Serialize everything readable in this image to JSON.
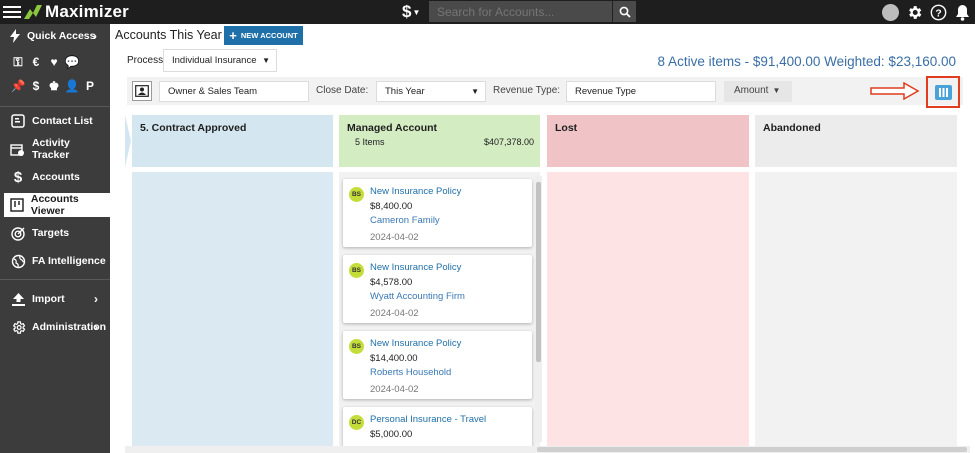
{
  "app": {
    "brand": "Maximizer",
    "currency_symbol": "$",
    "search_placeholder": "Search for Accounts..."
  },
  "sidebar": {
    "quick_access_label": "Quick Access",
    "quick_icons": [
      "key-icon",
      "euro-icon",
      "heart-icon",
      "chat-icon",
      "pin-icon",
      "dollar-icon",
      "user-icon",
      "person-icon",
      "p-badge-icon"
    ],
    "quick_glyphs": [
      "⚿",
      "€",
      "♥",
      "💬",
      "📌",
      "$",
      "♚",
      "👤",
      "P"
    ],
    "items": [
      {
        "label": "Contact List",
        "icon": "contact-list-icon"
      },
      {
        "label": "Activity Tracker",
        "icon": "calendar-icon"
      },
      {
        "label": "Accounts",
        "icon": "dollar-icon"
      },
      {
        "label": "Accounts Viewer",
        "icon": "kanban-icon",
        "active": true
      },
      {
        "label": "Targets",
        "icon": "target-icon"
      },
      {
        "label": "FA Intelligence",
        "icon": "globe-icon"
      },
      {
        "label": "Import",
        "icon": "upload-icon"
      },
      {
        "label": "Administration",
        "icon": "cog-icon"
      }
    ]
  },
  "header": {
    "title": "Accounts This Year",
    "new_account_label": "NEW ACCOUNT",
    "process_label": "Process:",
    "process_value": "Individual Insurance",
    "summary": "8 Active items - $91,400.00 Weighted: $23,160.00"
  },
  "filters": {
    "team_value": "Owner & Sales Team",
    "close_date_label": "Close Date:",
    "close_date_value": "This Year",
    "revenue_type_label": "Revenue Type:",
    "revenue_type_value": "Revenue Type",
    "amount_label": "Amount"
  },
  "columns": [
    {
      "title": "5. Contract Approved",
      "sub": "",
      "total": "",
      "head_color": "#d4e7f0",
      "body_color": "#dbeaf2"
    },
    {
      "title": "Managed Account",
      "sub": "5 Items",
      "total": "$407,378.00",
      "head_color": "#d4ecc2",
      "body_color": "#f2f2f2"
    },
    {
      "title": "Lost",
      "sub": "",
      "total": "",
      "head_color": "#f0c4c7",
      "body_color": "#fde3e4"
    },
    {
      "title": "Abandoned",
      "sub": "",
      "total": "",
      "head_color": "#ececec",
      "body_color": "#f2f2f2"
    }
  ],
  "cards": [
    {
      "initials": "BS",
      "title": "New Insurance Policy",
      "amount": "$8,400.00",
      "company": "Cameron Family",
      "date": "2024-04-02"
    },
    {
      "initials": "BS",
      "title": "New Insurance Policy",
      "amount": "$4,578.00",
      "company": "Wyatt Accounting Firm",
      "date": "2024-04-02"
    },
    {
      "initials": "BS",
      "title": "New Insurance Policy",
      "amount": "$14,400.00",
      "company": "Roberts Household",
      "date": "2024-04-02"
    },
    {
      "initials": "DC",
      "title": "Personal Insurance - Travel",
      "amount": "$5,000.00",
      "company": "",
      "date": ""
    }
  ],
  "colors": {
    "accent": "#1f6fa8",
    "highlight": "#e03d1f",
    "badge": "#c5dd3a"
  }
}
